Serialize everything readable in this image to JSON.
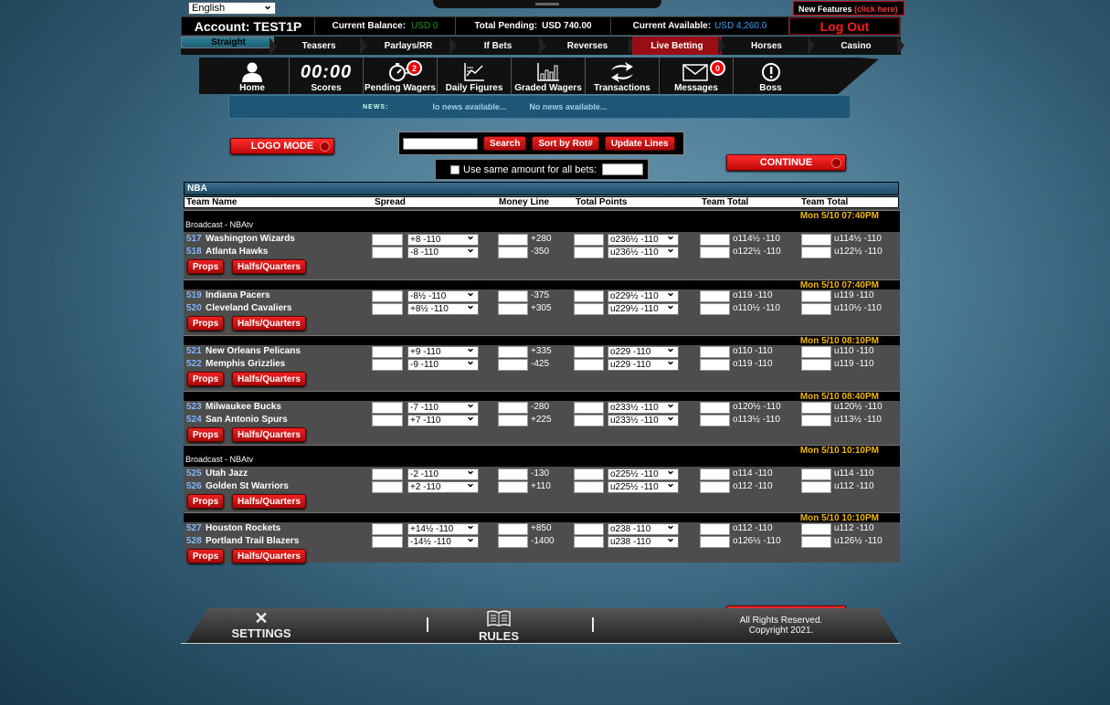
{
  "language": "English",
  "new_features": {
    "label": "New Features",
    "link": "(click here)"
  },
  "account": {
    "label": "Account: TEST1P",
    "balance_label": "Current Balance:",
    "balance": "USD 0",
    "pending_label": "Total Pending:",
    "pending": "USD 740.00",
    "available_label": "Current Available:",
    "available": "USD 4,260.0",
    "logout": "Log Out"
  },
  "nav": [
    "Straight",
    "Teasers",
    "Parlays/RR",
    "If Bets",
    "Reverses",
    "Live Betting",
    "Horses",
    "Casino"
  ],
  "icons": [
    {
      "label": "Home",
      "icon": "person-icon"
    },
    {
      "label": "Scores",
      "icon": "scoreboard-icon",
      "glyph": "00:00"
    },
    {
      "label": "Pending Wagers",
      "icon": "stopwatch-icon",
      "badge": "2"
    },
    {
      "label": "Daily Figures",
      "icon": "chart-icon"
    },
    {
      "label": "Graded Wagers",
      "icon": "bar-chart-icon"
    },
    {
      "label": "Transactions",
      "icon": "arrows-icon"
    },
    {
      "label": "Messages",
      "icon": "envelope-icon",
      "badge": "0"
    },
    {
      "label": "Boss",
      "icon": "alert-icon"
    }
  ],
  "news": {
    "label": "NEWS:",
    "msg1": "lo news available...",
    "msg2": "No news available..."
  },
  "buttons": {
    "logo_mode": "LOGO MODE",
    "continue": "CONTINUE",
    "search": "Search",
    "sort": "Sort by Rot#",
    "update": "Update Lines",
    "props": "Props",
    "halfs": "Halfs/Quarters"
  },
  "same_amount": "Use same amount for all bets:",
  "league": "NBA",
  "headers": {
    "team": "Team Name",
    "spread": "Spread",
    "money": "Money Line",
    "total": "Total Points",
    "tt1": "Team Total",
    "tt2": "Team Total"
  },
  "games": [
    {
      "date": "Mon 5/10  07:40PM",
      "broadcast": "Broadcast - NBAtv",
      "teams": [
        {
          "rot": "517",
          "name": "Washington Wizards",
          "spread": "+8 -110",
          "ml": "+280",
          "total": "o236½ -110",
          "tt1": "o114½ -110",
          "tt2": "u114½ -110"
        },
        {
          "rot": "518",
          "name": "Atlanta Hawks",
          "spread": "-8 -110",
          "ml": "-350",
          "total": "u236½ -110",
          "tt1": "o122½  -110",
          "tt2": "u122½  -110"
        }
      ]
    },
    {
      "date": "Mon 5/10  07:40PM",
      "broadcast": "",
      "teams": [
        {
          "rot": "519",
          "name": "Indiana Pacers",
          "spread": "-8½ -110",
          "ml": "-375",
          "total": "o229½ -110",
          "tt1": "o119 -110",
          "tt2": "u119 -110"
        },
        {
          "rot": "520",
          "name": "Cleveland Cavaliers",
          "spread": "+8½ -110",
          "ml": "+305",
          "total": "u229½ -110",
          "tt1": "o110½  -110",
          "tt2": "u110½  -110"
        }
      ]
    },
    {
      "date": "Mon 5/10  08:10PM",
      "broadcast": "",
      "teams": [
        {
          "rot": "521",
          "name": "New Orleans Pelicans",
          "spread": "+9 -110",
          "ml": "+335",
          "total": "o229 -110",
          "tt1": "o110 -110",
          "tt2": "u110 -110"
        },
        {
          "rot": "522",
          "name": "Memphis Grizzlies",
          "spread": "-9 -110",
          "ml": "-425",
          "total": "u229 -110",
          "tt1": "o119  -110",
          "tt2": "u119  -110"
        }
      ]
    },
    {
      "date": "Mon 5/10  08:40PM",
      "broadcast": "",
      "teams": [
        {
          "rot": "523",
          "name": "Milwaukee Bucks",
          "spread": "-7 -110",
          "ml": "-280",
          "total": "o233½ -110",
          "tt1": "o120½ -110",
          "tt2": "u120½ -110"
        },
        {
          "rot": "524",
          "name": "San Antonio Spurs",
          "spread": "+7 -110",
          "ml": "+225",
          "total": "u233½ -110",
          "tt1": "o113½  -110",
          "tt2": "u113½  -110"
        }
      ]
    },
    {
      "date": "Mon 5/10  10:10PM",
      "broadcast": "Broadcast - NBAtv",
      "teams": [
        {
          "rot": "525",
          "name": "Utah Jazz",
          "spread": "-2 -110",
          "ml": "-130",
          "total": "o225½ -110",
          "tt1": "o114 -110",
          "tt2": "u114 -110"
        },
        {
          "rot": "526",
          "name": "Golden St Warriors",
          "spread": "+2 -110",
          "ml": "+110",
          "total": "u225½ -110",
          "tt1": "o112  -110",
          "tt2": "u112  -110"
        }
      ]
    },
    {
      "date": "Mon 5/10  10:10PM",
      "broadcast": "",
      "teams": [
        {
          "rot": "527",
          "name": "Houston Rockets",
          "spread": "+14½ -110",
          "ml": "+850",
          "total": "o238 -110",
          "tt1": "o112 -110",
          "tt2": "u112 -110"
        },
        {
          "rot": "528",
          "name": "Portland Trail Blazers",
          "spread": "-14½ -110",
          "ml": "-1400",
          "total": "u238 -110",
          "tt1": "o126½  -110",
          "tt2": "u126½  -110"
        }
      ]
    }
  ],
  "footer": {
    "settings": "SETTINGS",
    "rules": "RULES",
    "rights": "All Rights Reserved.",
    "copyright": "Copyright 2021."
  }
}
